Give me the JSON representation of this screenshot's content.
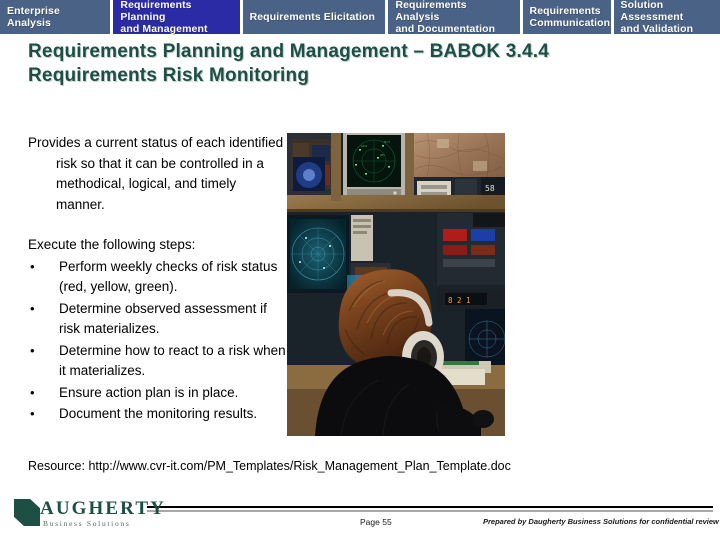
{
  "tabstrip": {
    "tabs": [
      {
        "label": "Enterprise Analysis",
        "active": false
      },
      {
        "label": "Requirements Planning\nand Management",
        "active": true
      },
      {
        "label": "Requirements Elicitation",
        "active": false
      },
      {
        "label": "Requirements Analysis\nand Documentation",
        "active": false
      },
      {
        "label": "Requirements\nCommunication",
        "active": false
      },
      {
        "label": "Solution Assessment\nand Validation",
        "active": false
      }
    ],
    "colors": {
      "inactive_bg": "#4a6285",
      "active_bg": "#2b2ba5",
      "text": "#ffffff"
    }
  },
  "title": {
    "line1": "Requirements Planning and Management – BABOK 3.4.4",
    "line2": "Requirements Risk Monitoring",
    "color": "#1d4f45"
  },
  "body": {
    "intro": "Provides a current status of each identified risk so that it can be controlled in a methodical, logical, and timely manner.",
    "steps_lead": "Execute the following steps:",
    "bullet_glyph": "•",
    "steps": [
      "Perform weekly checks of risk status (red, yellow, green).",
      "Determine observed assessment if risk materializes.",
      "Determine how to react to a risk when it materializes.",
      "Ensure action plan is in place.",
      "Document the monitoring results."
    ]
  },
  "photo": {
    "alt": "air-traffic-controller-at-radar-console"
  },
  "resource": {
    "text": "Resource: http://www.cvr-it.com/PM_Templates/Risk_Management_Plan_Template.doc"
  },
  "footer": {
    "logo_initial": "D",
    "logo_name": "AUGHERTY",
    "logo_tagline": "Business Solutions",
    "page": "Page 55",
    "note": "Prepared by Daugherty Business Solutions for confidential review"
  }
}
